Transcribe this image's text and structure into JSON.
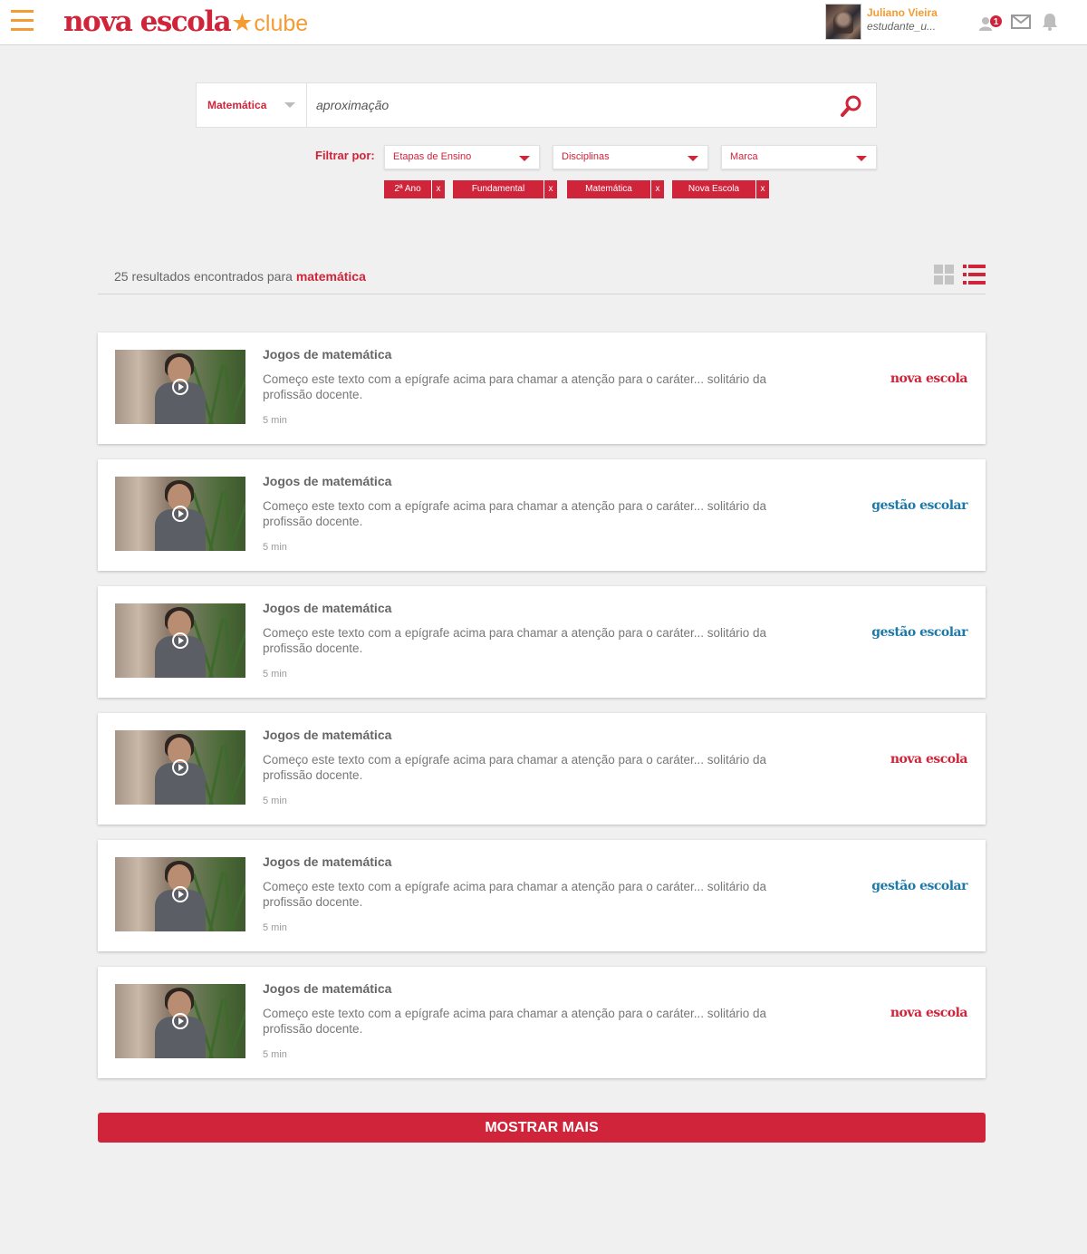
{
  "header": {
    "logo": {
      "main": "nova escola",
      "sub": "clube"
    },
    "user": {
      "name": "Juliano Vieira",
      "handle": "estudante_u..."
    },
    "friend_requests_count": "1",
    "colors": {
      "brand_red": "#d0243b",
      "accent_orange": "#f39c33",
      "gestao_blue": "#1e78a8"
    }
  },
  "search": {
    "category": "Matemática",
    "query": "aproximação"
  },
  "filters": {
    "label": "Filtrar por:",
    "dropdowns": [
      "Etapas de Ensino",
      "Disciplinas",
      "Marca"
    ],
    "chips": [
      "2ª Ano",
      "Fundamental",
      "Matemática",
      "Nova Escola"
    ],
    "remove_label": "x"
  },
  "results": {
    "count_text": "25 resultados encontrados para",
    "term": "matemática",
    "items": [
      {
        "title": "Jogos de matemática",
        "description": "Começo este texto com a epígrafe acima para chamar a atenção para o caráter... solitário da profissão docente.",
        "duration": "5 min",
        "brand": "nova escola",
        "brand_type": "nova"
      },
      {
        "title": "Jogos de matemática",
        "description": "Começo este texto com a epígrafe acima para chamar a atenção para o caráter... solitário da profissão docente.",
        "duration": "5 min",
        "brand": "gestão escolar",
        "brand_type": "gestao"
      },
      {
        "title": "Jogos de matemática",
        "description": "Começo este texto com a epígrafe acima para chamar a atenção para o caráter... solitário da profissão docente.",
        "duration": "5 min",
        "brand": "gestão escolar",
        "brand_type": "gestao"
      },
      {
        "title": "Jogos de matemática",
        "description": "Começo este texto com a epígrafe acima para chamar a atenção para o caráter... solitário da profissão docente.",
        "duration": "5 min",
        "brand": "nova escola",
        "brand_type": "nova"
      },
      {
        "title": "Jogos de matemática",
        "description": "Começo este texto com a epígrafe acima para chamar a atenção para o caráter... solitário da profissão docente.",
        "duration": "5 min",
        "brand": "gestão escolar",
        "brand_type": "gestao"
      },
      {
        "title": "Jogos de matemática",
        "description": "Começo este texto com a epígrafe acima para chamar a atenção para o caráter... solitário da profissão docente.",
        "duration": "5 min",
        "brand": "nova escola",
        "brand_type": "nova"
      }
    ]
  },
  "more_button_label": "MOSTRAR MAIS"
}
